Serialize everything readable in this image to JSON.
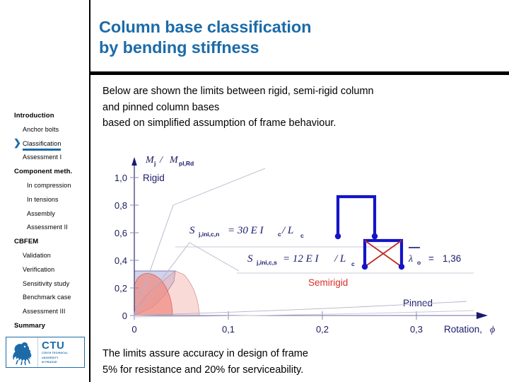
{
  "slide": {
    "title_line1": "Column base classification",
    "title_line2": "by bending stiffness",
    "intro_line1": "Below are shown the limits between rigid, semi-rigid column",
    "intro_line2": "and pinned column bases",
    "intro_line3": "based on simplified assumption of frame behaviour.",
    "conclusion_line1": "The limits assure accuracy in design of frame",
    "conclusion_line2": "5% for resistance and 20% for serviceability.",
    "title_color": "#1C6BA8"
  },
  "sidebar": {
    "items": [
      {
        "label": "Introduction",
        "level": 0,
        "current": false
      },
      {
        "label": "Anchor bolts",
        "level": 1,
        "current": false
      },
      {
        "label": "Classification",
        "level": 1,
        "current": true
      },
      {
        "label": "Assessment I",
        "level": 1,
        "current": false
      },
      {
        "label": "Component meth.",
        "level": 0,
        "current": false
      },
      {
        "label": "In compression",
        "level": 2,
        "current": false
      },
      {
        "label": "In tensions",
        "level": 2,
        "current": false
      },
      {
        "label": "Assembly",
        "level": 2,
        "current": false
      },
      {
        "label": "Assessment II",
        "level": 2,
        "current": false
      },
      {
        "label": "CBFEM",
        "level": 0,
        "current": false
      },
      {
        "label": "Validation",
        "level": 1,
        "current": false
      },
      {
        "label": "Verification",
        "level": 1,
        "current": false
      },
      {
        "label": "Sensitivity study",
        "level": 1,
        "current": false
      },
      {
        "label": "Benchmark case",
        "level": 1,
        "current": false
      },
      {
        "label": "Assessment III",
        "level": 1,
        "current": false
      },
      {
        "label": "Summary",
        "level": 0,
        "current": false
      }
    ],
    "current_marker": "❯",
    "accent_color": "#1C6BA8"
  },
  "logo": {
    "acronym": "CTU",
    "sub_line1": "CZECH TECHNICAL",
    "sub_line2": "UNIVERSITY",
    "sub_line3": "IN PRAGUE",
    "color": "#1C6BA8"
  },
  "chart_data": {
    "type": "line",
    "title": "",
    "ylabel": "Mj / Mpl,Rd",
    "ylabel_main": "M",
    "ylabel_main_sub": "j",
    "ylabel_sep": "/",
    "ylabel_den": "M",
    "ylabel_den_sub": "pl,Rd",
    "xlabel": "Rotation,",
    "xlabel_symbol": "ϕ",
    "xticks": [
      "0",
      "0,1",
      "0,2",
      "0,3"
    ],
    "xtick_values": [
      0,
      0.1,
      0.2,
      0.3
    ],
    "yticks": [
      "0",
      "0,2",
      "0,4",
      "0,6",
      "0,8",
      "1,0"
    ],
    "ytick_values": [
      0,
      0.2,
      0.4,
      0.6,
      0.8,
      1.0
    ],
    "xlim": [
      0,
      0.36
    ],
    "ylim": [
      0,
      1.08
    ],
    "grid": false,
    "zones": [
      {
        "name": "Rigid",
        "label": "Rigid",
        "color": "#1a1a6e",
        "x": 0.005,
        "y": 1.0
      },
      {
        "name": "Semirigid",
        "label": "Semirigid",
        "color": "#d83027",
        "x": 0.215,
        "y": 0.12
      },
      {
        "name": "Pinned",
        "label": "Pinned",
        "color": "#1a1a6e",
        "x": 0.3,
        "y": 0.045
      }
    ],
    "series": [
      {
        "name": "S j,ini,c,n = 30 E Ic / Lc",
        "slope_label": "30 E Ic / Lc",
        "formula_main": "S",
        "formula_sub": "j,ini,c,n",
        "formula_rest": "= 30 E I",
        "formula_rest_sub": "c",
        "formula_tail": "/ L",
        "formula_tail_sub": "c"
      },
      {
        "name": "S j,ini,c,s = 12 E I / Lc",
        "slope_label": "12 E I / Lc",
        "formula_main": "S",
        "formula_sub": "j,ini,c,s",
        "formula_rest": "= 12 E I",
        "formula_rest_sub": "",
        "formula_tail": "/ L",
        "formula_tail_sub": "c"
      }
    ],
    "annotations": [
      {
        "name": "slenderness",
        "symbol": "λ",
        "sub": "o",
        "eq": "=",
        "value": "1,36",
        "overbar": true
      }
    ],
    "frames": [
      {
        "name": "sway-frame",
        "braced": false
      },
      {
        "name": "braced-frame",
        "braced": true
      }
    ]
  }
}
